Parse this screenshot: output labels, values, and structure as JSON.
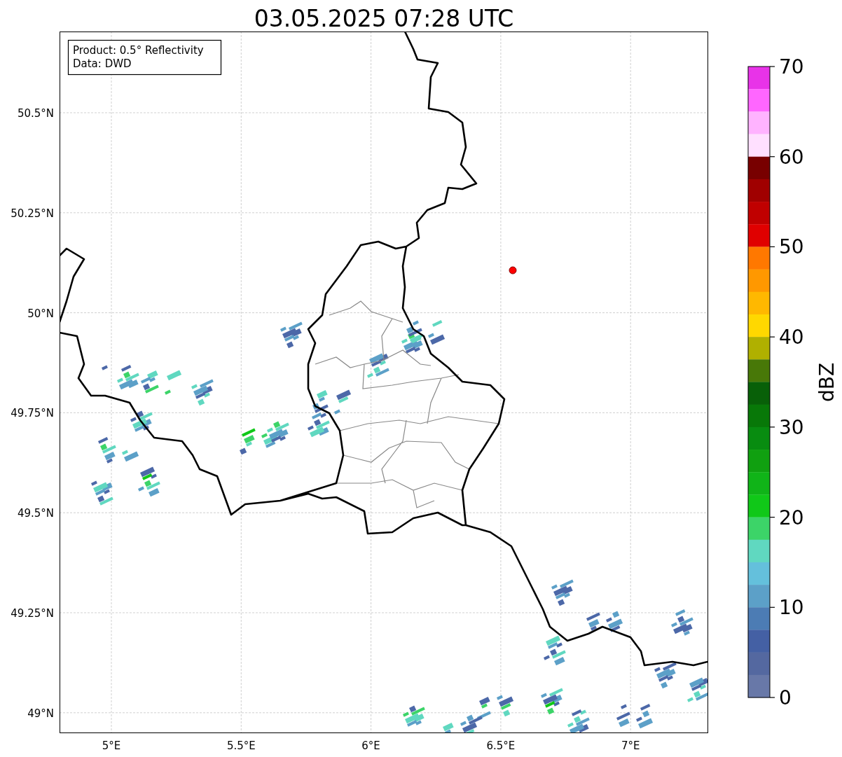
{
  "title": "03.05.2025 07:28 UTC",
  "info_box": {
    "lines": [
      "Product: 0.5° Reflectivity",
      "Data: DWD"
    ]
  },
  "map": {
    "y_ticks": [
      "50.5°N",
      "50.25°N",
      "50°N",
      "49.75°N",
      "49.5°N",
      "49.25°N",
      "49°N"
    ],
    "x_ticks": [
      "5°E",
      "5.5°E",
      "6°E",
      "6.5°E",
      "7°E"
    ]
  },
  "colorbar": {
    "label": "dBZ",
    "ticks": [
      "70",
      "60",
      "50",
      "40",
      "30",
      "20",
      "10",
      "0"
    ],
    "bands": [
      {
        "color": "#e833e8"
      },
      {
        "color": "#ff66ff"
      },
      {
        "color": "#ffb3ff"
      },
      {
        "color": "#ffe0ff"
      },
      {
        "color": "#780000"
      },
      {
        "color": "#a00000"
      },
      {
        "color": "#c00000"
      },
      {
        "color": "#e00000"
      },
      {
        "color": "#ff7800"
      },
      {
        "color": "#ff9800"
      },
      {
        "color": "#ffb800"
      },
      {
        "color": "#ffd800"
      },
      {
        "color": "#b0b000"
      },
      {
        "color": "#487808"
      },
      {
        "color": "#086008"
      },
      {
        "color": "#087808"
      },
      {
        "color": "#088c10"
      },
      {
        "color": "#10a010"
      },
      {
        "color": "#10b418"
      },
      {
        "color": "#10c818"
      },
      {
        "color": "#3cd468"
      },
      {
        "color": "#60d8c0"
      },
      {
        "color": "#64c0dc"
      },
      {
        "color": "#5ca0c8"
      },
      {
        "color": "#4c7cb4"
      },
      {
        "color": "#4460a4"
      },
      {
        "color": "#5468a0"
      },
      {
        "color": "#6878a8"
      }
    ]
  }
}
